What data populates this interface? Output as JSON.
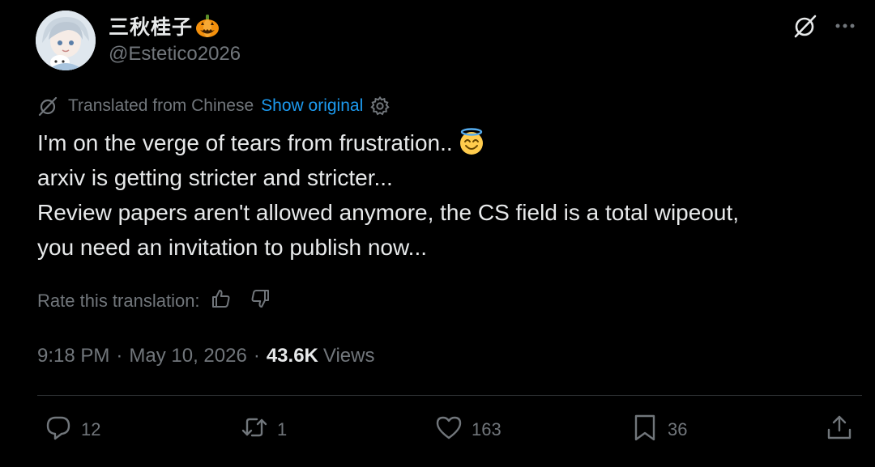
{
  "author": {
    "display_name": "三秋桂子",
    "handle": "@Estetico2026"
  },
  "translation": {
    "notice": "Translated from Chinese",
    "show_original": "Show original"
  },
  "tweet": {
    "lines": [
      "I'm on the verge of tears from frustration..",
      "arxiv is getting stricter and stricter...",
      "Review papers aren't allowed anymore, the CS field is a total wipeout,",
      "you need an invitation to publish now..."
    ]
  },
  "rating": {
    "label": "Rate this translation:"
  },
  "meta": {
    "time": "9:18 PM",
    "separator": "·",
    "date": "May 10, 2026",
    "views_count": "43.6K",
    "views_label": "Views"
  },
  "actions": {
    "replies": "12",
    "reposts": "1",
    "likes": "163",
    "bookmarks": "36"
  },
  "icons": {
    "grok": "grok-icon",
    "more": "more-icon",
    "translate": "translate-icon",
    "settings": "gear-icon",
    "thumb_up": "thumbs-up-icon",
    "thumb_down": "thumbs-down-icon",
    "reply": "reply-icon",
    "repost": "repost-icon",
    "like": "heart-icon",
    "bookmark": "bookmark-icon",
    "share": "share-icon"
  },
  "colors": {
    "background": "#000000",
    "text": "#e7e9ea",
    "secondary": "#71767b",
    "link": "#1d9bf0",
    "divider": "#2f3336"
  }
}
